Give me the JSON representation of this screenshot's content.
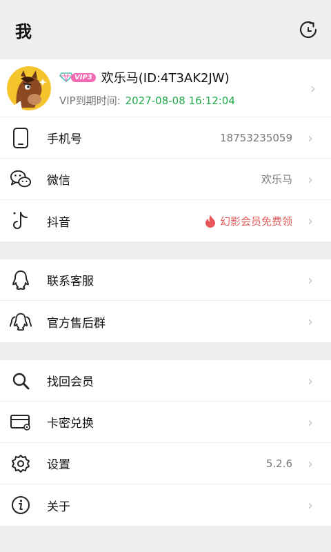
{
  "header": {
    "title": "我",
    "refresh_icon": "refresh-icon"
  },
  "profile": {
    "vip_label": "VIP3",
    "nickname": "欢乐马(ID:4T3AK2JW)",
    "expiry_label": "VIP到期时间:",
    "expiry_date": "2027-08-08 16:12:04",
    "colors": {
      "vip_badge": "#f36ab3",
      "expiry": "#22a94a"
    }
  },
  "section1": {
    "phone": {
      "label": "手机号",
      "value": "18753235059",
      "icon": "phone-icon"
    },
    "wechat": {
      "label": "微信",
      "value": "欢乐马",
      "icon": "wechat-icon"
    },
    "douyin": {
      "label": "抖音",
      "value": "幻影会员免费领",
      "icon": "tiktok-icon",
      "value_color": "#e25a5a"
    }
  },
  "section2": {
    "contact": {
      "label": "联系客服",
      "icon": "qq-icon"
    },
    "group": {
      "label": "官方售后群",
      "icon": "qq-group-icon"
    }
  },
  "section3": {
    "recover": {
      "label": "找回会员",
      "icon": "search-icon"
    },
    "redeem": {
      "label": "卡密兑换",
      "icon": "card-icon"
    },
    "settings": {
      "label": "设置",
      "value": "5.2.6",
      "icon": "gear-icon"
    },
    "about": {
      "label": "关于",
      "icon": "info-icon"
    }
  }
}
